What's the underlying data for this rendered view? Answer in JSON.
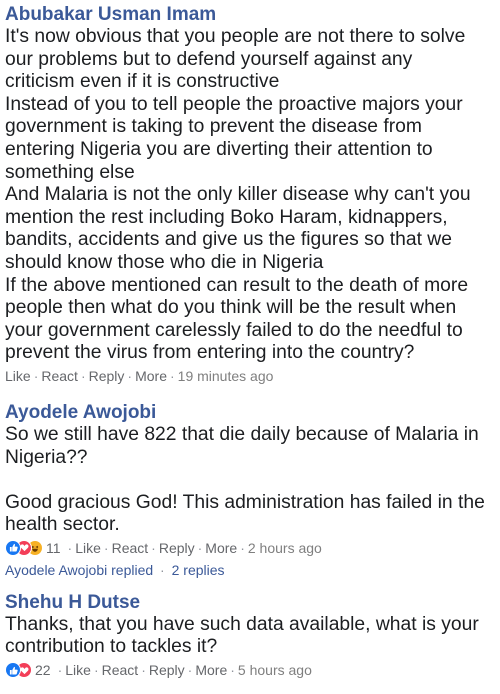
{
  "comments": [
    {
      "author": "Abubakar Usman Imam",
      "lines": [
        "It's now obvious that you people are not there to solve",
        "our problems but to defend yourself against any",
        "criticism even if it is constructive",
        "Instead of you to tell people the proactive majors your",
        "government is taking to prevent the disease from",
        "entering Nigeria you are diverting their attention to",
        "something else",
        "And Malaria is not the only killer disease why can't you",
        "mention the rest including Boko Haram, kidnappers,",
        "bandits, accidents and give us the figures so that we",
        "should know those who die in Nigeria",
        "If the above mentioned can result to the death of more",
        "people then what do you think will be the result when",
        "your government carelessly failed to do the needful to",
        "prevent the virus from entering into the country?"
      ],
      "like": "Like",
      "react": "React",
      "reply": "Reply",
      "more": "More",
      "time": "19 minutes ago"
    },
    {
      "author": "Ayodele Awojobi",
      "lines": [
        "So we still have 822 that die daily because of Malaria in",
        "Nigeria??",
        "",
        "Good gracious God! This administration has failed in the",
        "health sector."
      ],
      "reaction_count": "11",
      "like": "Like",
      "react": "React",
      "reply": "Reply",
      "more": "More",
      "time": "2 hours ago",
      "replied_text": "Ayodele Awojobi replied",
      "replies_count": "2 replies"
    },
    {
      "author": "Shehu H Dutse",
      "lines": [
        "Thanks, that you have such data available, what is your",
        "contribution to tackles it?"
      ],
      "reaction_count": "22",
      "like": "Like",
      "react": "React",
      "reply": "Reply",
      "more": "More",
      "time": "5 hours ago"
    }
  ],
  "separator": "·",
  "colors": {
    "author": "#3b5998",
    "like_reaction": "#1877f2",
    "love_reaction": "#f33e58",
    "haha_reaction": "#f7b125",
    "meta_text": "#7f7f7f"
  },
  "icons": [
    "like-reaction-icon",
    "love-reaction-icon",
    "haha-reaction-icon"
  ]
}
